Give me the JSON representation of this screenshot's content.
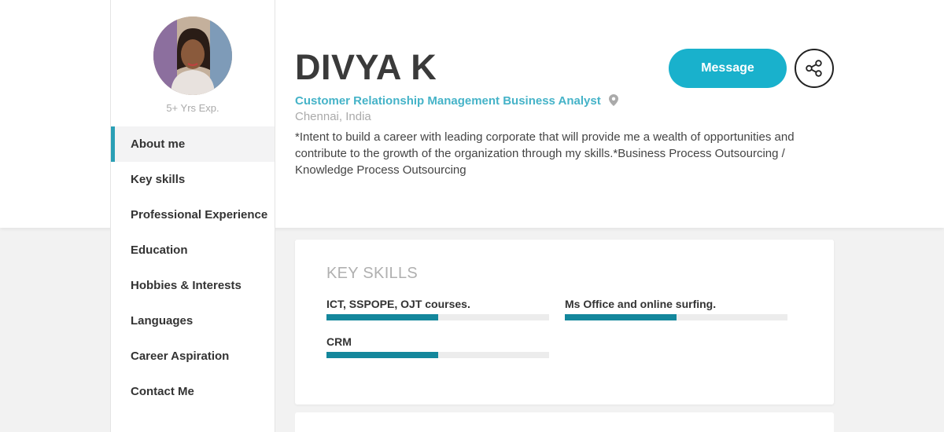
{
  "profile": {
    "name": "DIVYA K",
    "experience": "5+ Yrs Exp.",
    "job_title": "Customer Relationship Management Business Analyst",
    "location": "Chennai, India",
    "about": "*Intent to build a career with leading corporate that will provide me a wealth of opportunities and contribute to the growth of the organization through my skills.*Business Process Outsourcing / Knowledge Process Outsourcing"
  },
  "actions": {
    "message_label": "Message",
    "share_icon": "share-icon"
  },
  "sidebar": {
    "items": [
      {
        "label": "About me",
        "active": true
      },
      {
        "label": "Key skills"
      },
      {
        "label": "Professional Experience"
      },
      {
        "label": "Education"
      },
      {
        "label": "Hobbies & Interests"
      },
      {
        "label": "Languages"
      },
      {
        "label": "Career Aspiration"
      },
      {
        "label": "Contact Me"
      }
    ]
  },
  "key_skills": {
    "title": "KEY SKILLS",
    "skills": [
      {
        "label": " ICT, SSPOPE, OJT courses.",
        "level": 0.5
      },
      {
        "label": " Ms Office and online surfing.",
        "level": 0.5
      },
      {
        "label": "CRM",
        "level": 0.5
      }
    ]
  },
  "colors": {
    "accent": "#19b1cc",
    "job_title": "#45b3c8",
    "skill_bar": "#14879c",
    "nav_active_border": "#2a9fb5"
  }
}
